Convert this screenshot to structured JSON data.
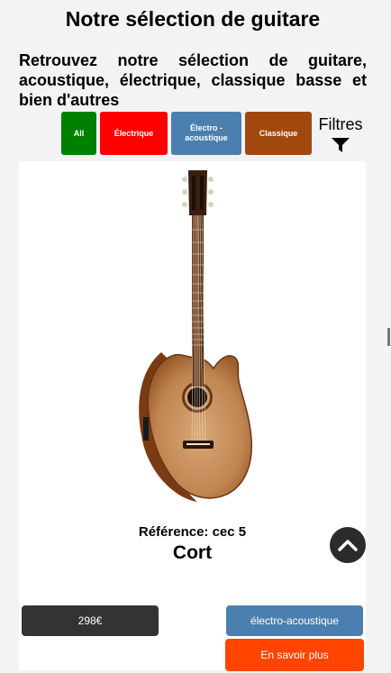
{
  "header": {
    "title": "Notre sélection de guitare",
    "intro": "Retrouvez notre sélection de guitare, acoustique, électrique, classique basse et bien d'autres"
  },
  "filters": {
    "buttons": [
      {
        "label": "All",
        "color": "#008000"
      },
      {
        "label": "Électrique",
        "color": "#ff0000"
      },
      {
        "label": "Électro - acoustique",
        "color": "#4a7fb0"
      },
      {
        "label": "Classique",
        "color": "#a0480e"
      }
    ],
    "toggle_label": "Filtres",
    "toggle_icon": "funnel-icon"
  },
  "product": {
    "reference": "Référence: cec 5",
    "brand": "Cort",
    "price": "298€",
    "category": "électro-acoustique",
    "more_label": "En savoir plus",
    "image": "guitar-image"
  },
  "scroll_top": {
    "icon": "chevron-up-icon"
  },
  "colors": {
    "background": "#f3f3f3",
    "price_bg": "#333333",
    "category_bg": "#4a7fb0",
    "more_bg": "#ff4500"
  }
}
